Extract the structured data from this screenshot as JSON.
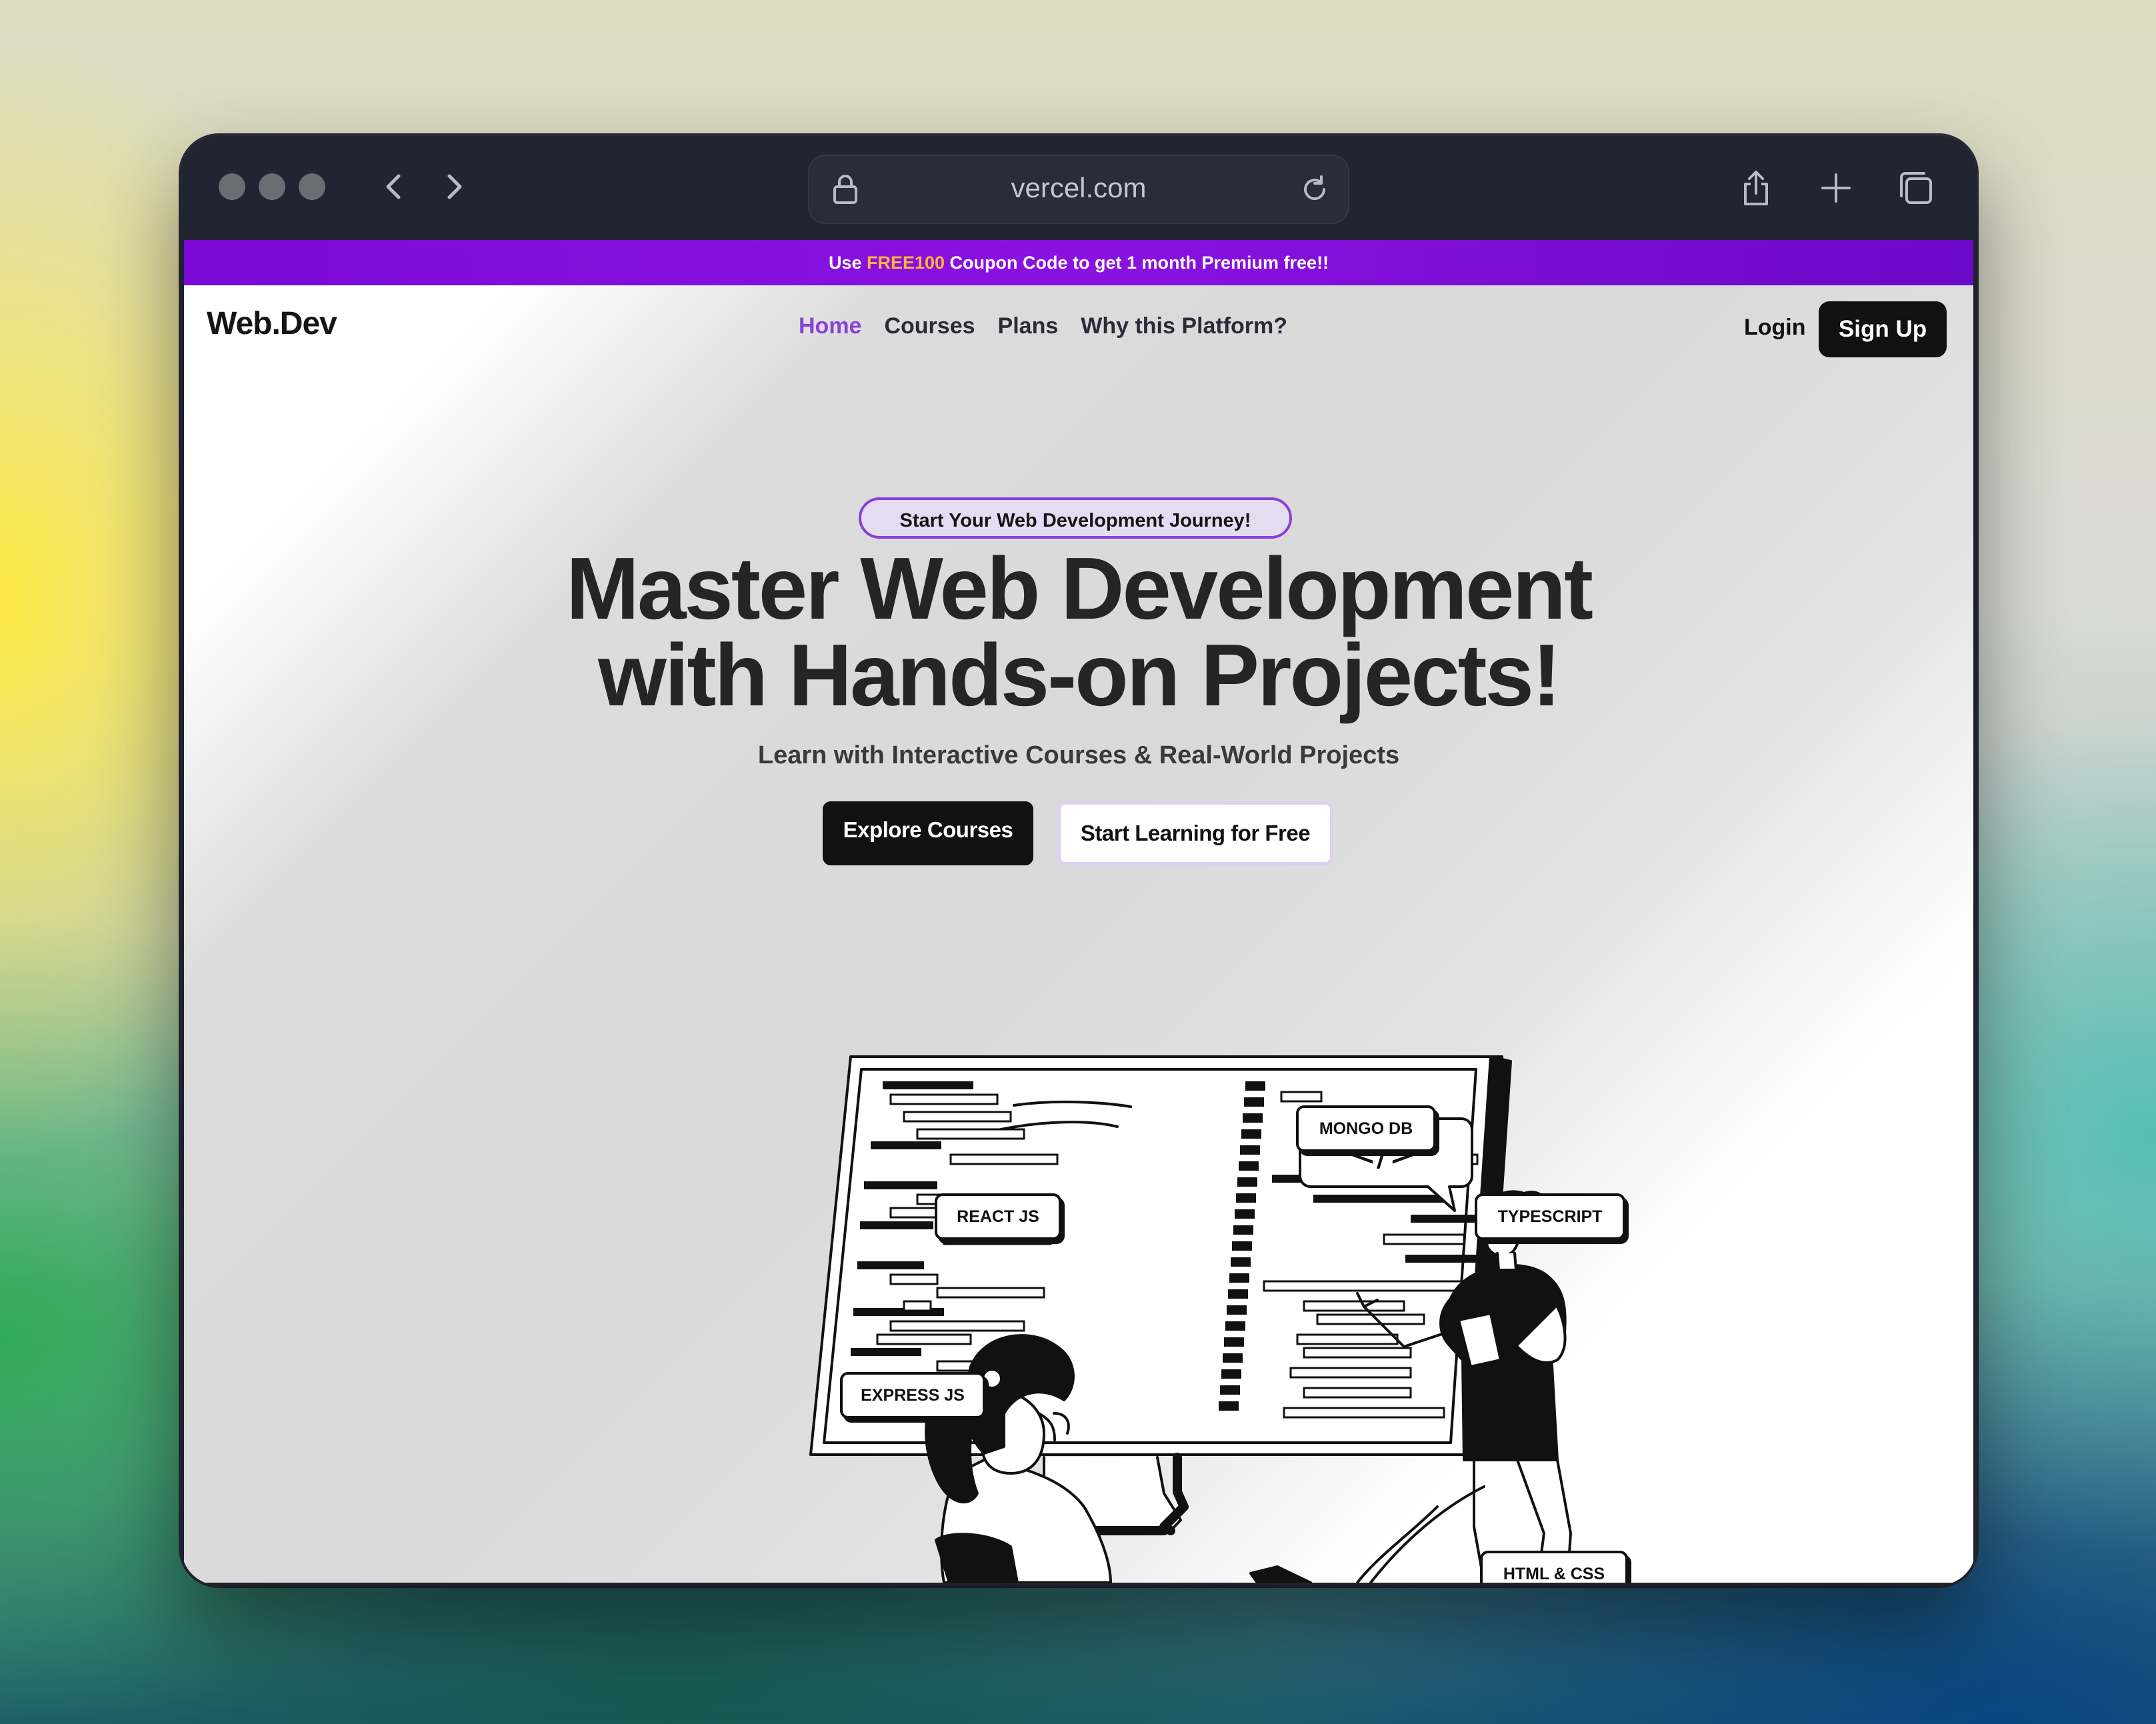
{
  "browser": {
    "url": "vercel.com"
  },
  "promo": {
    "prefix": "Use ",
    "code": "FREE100",
    "suffix": " Coupon Code to get 1 month Premium free!!"
  },
  "site": {
    "logo": "Web.Dev",
    "nav": [
      {
        "label": "Home",
        "active": true
      },
      {
        "label": "Courses",
        "active": false
      },
      {
        "label": "Plans",
        "active": false
      },
      {
        "label": "Why this Platform?",
        "active": false
      }
    ],
    "login_label": "Login",
    "signup_label": "Sign Up"
  },
  "hero": {
    "badge": "Start Your Web Development Journey!",
    "title_line1": "Master Web Development",
    "title_line2": "with Hands-on Projects!",
    "subtitle": "Learn with Interactive Courses & Real-World Projects",
    "primary_cta": "Explore Courses",
    "secondary_cta": "Start Learning for Free"
  },
  "illustration": {
    "code_symbol": "</>",
    "tags": [
      "MONGO DB",
      "REACT JS",
      "TYPESCRIPT",
      "EXPRESS JS",
      "HTML & CSS"
    ]
  },
  "colors": {
    "accent": "#8a3fd8",
    "promo_bg": "#7b0ad6",
    "coupon_code": "#ffb13d",
    "button_dark": "#111111"
  }
}
